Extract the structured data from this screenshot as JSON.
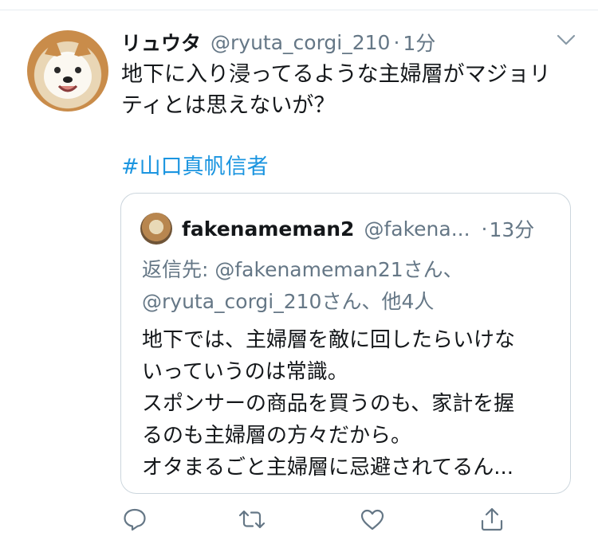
{
  "tweet": {
    "author_name": "リュウタ",
    "author_handle": "@ryuta_corgi_210",
    "separator": "·",
    "time": "1分",
    "text_lines": [
      "地下に入り浸ってるような主婦層がマジョリ",
      "ティとは思えないが？"
    ],
    "hashtag": "#山口真帆信者"
  },
  "quoted_tweet": {
    "author_name": "fakenameman2",
    "author_handle": "@fakena...",
    "separator": "·",
    "time": "13分",
    "reply_lines": [
      "返信先: @fakenameman21さん、",
      "@ryuta_corgi_210さん、他4人"
    ],
    "text_lines": [
      "地下では、主婦層を敵に回したらいけな",
      "いっていうのは常識。",
      "スポンサーの商品を買うのも、家計を握",
      "るのも主婦層の方々だから。",
      "オタまるごと主婦層に忌避されてるん..."
    ]
  },
  "icons": {
    "reply": "reply-icon",
    "retweet": "retweet-icon",
    "like": "like-icon",
    "share": "share-icon",
    "menu": "chevron-down-icon"
  },
  "colors": {
    "link": "#1b95e0",
    "secondary": "#657786",
    "border": "#ccd6dd",
    "text": "#14171a"
  }
}
